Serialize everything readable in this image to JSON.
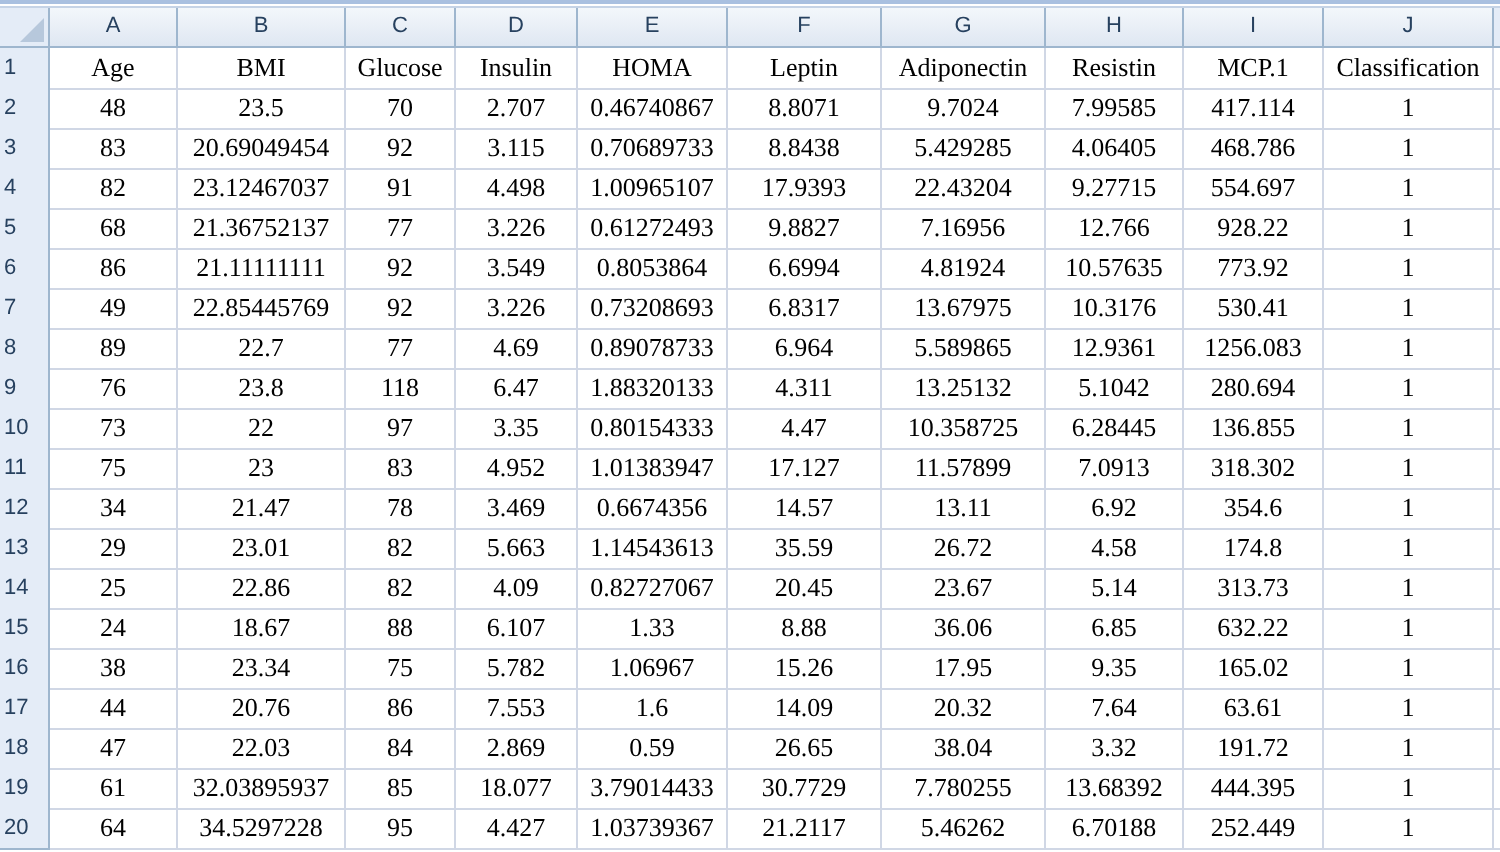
{
  "column_headers": [
    "A",
    "B",
    "C",
    "D",
    "E",
    "F",
    "G",
    "H",
    "I",
    "J"
  ],
  "rows": [
    {
      "number": "1",
      "cells": [
        "Age",
        "BMI",
        "Glucose",
        "Insulin",
        "HOMA",
        "Leptin",
        "Adiponectin",
        "Resistin",
        "MCP.1",
        "Classification"
      ]
    },
    {
      "number": "2",
      "cells": [
        "48",
        "23.5",
        "70",
        "2.707",
        "0.46740867",
        "8.8071",
        "9.7024",
        "7.99585",
        "417.114",
        "1"
      ]
    },
    {
      "number": "3",
      "cells": [
        "83",
        "20.69049454",
        "92",
        "3.115",
        "0.70689733",
        "8.8438",
        "5.429285",
        "4.06405",
        "468.786",
        "1"
      ]
    },
    {
      "number": "4",
      "cells": [
        "82",
        "23.12467037",
        "91",
        "4.498",
        "1.00965107",
        "17.9393",
        "22.43204",
        "9.27715",
        "554.697",
        "1"
      ]
    },
    {
      "number": "5",
      "cells": [
        "68",
        "21.36752137",
        "77",
        "3.226",
        "0.61272493",
        "9.8827",
        "7.16956",
        "12.766",
        "928.22",
        "1"
      ]
    },
    {
      "number": "6",
      "cells": [
        "86",
        "21.11111111",
        "92",
        "3.549",
        "0.8053864",
        "6.6994",
        "4.81924",
        "10.57635",
        "773.92",
        "1"
      ]
    },
    {
      "number": "7",
      "cells": [
        "49",
        "22.85445769",
        "92",
        "3.226",
        "0.73208693",
        "6.8317",
        "13.67975",
        "10.3176",
        "530.41",
        "1"
      ]
    },
    {
      "number": "8",
      "cells": [
        "89",
        "22.7",
        "77",
        "4.69",
        "0.89078733",
        "6.964",
        "5.589865",
        "12.9361",
        "1256.083",
        "1"
      ]
    },
    {
      "number": "9",
      "cells": [
        "76",
        "23.8",
        "118",
        "6.47",
        "1.88320133",
        "4.311",
        "13.25132",
        "5.1042",
        "280.694",
        "1"
      ]
    },
    {
      "number": "10",
      "cells": [
        "73",
        "22",
        "97",
        "3.35",
        "0.80154333",
        "4.47",
        "10.358725",
        "6.28445",
        "136.855",
        "1"
      ]
    },
    {
      "number": "11",
      "cells": [
        "75",
        "23",
        "83",
        "4.952",
        "1.01383947",
        "17.127",
        "11.57899",
        "7.0913",
        "318.302",
        "1"
      ]
    },
    {
      "number": "12",
      "cells": [
        "34",
        "21.47",
        "78",
        "3.469",
        "0.6674356",
        "14.57",
        "13.11",
        "6.92",
        "354.6",
        "1"
      ]
    },
    {
      "number": "13",
      "cells": [
        "29",
        "23.01",
        "82",
        "5.663",
        "1.14543613",
        "35.59",
        "26.72",
        "4.58",
        "174.8",
        "1"
      ]
    },
    {
      "number": "14",
      "cells": [
        "25",
        "22.86",
        "82",
        "4.09",
        "0.82727067",
        "20.45",
        "23.67",
        "5.14",
        "313.73",
        "1"
      ]
    },
    {
      "number": "15",
      "cells": [
        "24",
        "18.67",
        "88",
        "6.107",
        "1.33",
        "8.88",
        "36.06",
        "6.85",
        "632.22",
        "1"
      ]
    },
    {
      "number": "16",
      "cells": [
        "38",
        "23.34",
        "75",
        "5.782",
        "1.06967",
        "15.26",
        "17.95",
        "9.35",
        "165.02",
        "1"
      ]
    },
    {
      "number": "17",
      "cells": [
        "44",
        "20.76",
        "86",
        "7.553",
        "1.6",
        "14.09",
        "20.32",
        "7.64",
        "63.61",
        "1"
      ]
    },
    {
      "number": "18",
      "cells": [
        "47",
        "22.03",
        "84",
        "2.869",
        "0.59",
        "26.65",
        "38.04",
        "3.32",
        "191.72",
        "1"
      ]
    },
    {
      "number": "19",
      "cells": [
        "61",
        "32.03895937",
        "85",
        "18.077",
        "3.79014433",
        "30.7729",
        "7.780255",
        "13.68392",
        "444.395",
        "1"
      ]
    },
    {
      "number": "20",
      "cells": [
        "64",
        "34.5297228",
        "95",
        "4.427",
        "1.03739367",
        "21.2117",
        "5.46262",
        "6.70188",
        "252.449",
        "1"
      ]
    }
  ]
}
